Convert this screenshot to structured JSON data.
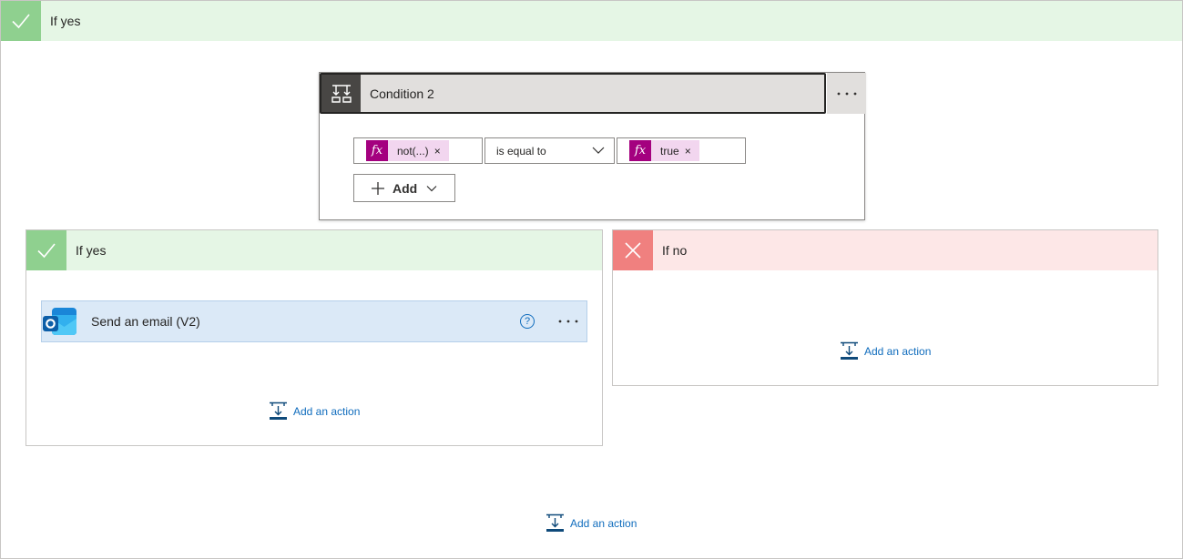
{
  "outer_branch": {
    "label": "If yes",
    "add_action_label": "Add an action"
  },
  "condition": {
    "title": "Condition 2",
    "left_token": {
      "icon": "fx-icon",
      "text": "not(...)",
      "remove": "×"
    },
    "operator": "is equal to",
    "right_token": {
      "icon": "fx-icon",
      "text": "true",
      "remove": "×"
    },
    "add_label": "Add"
  },
  "yes_branch": {
    "label": "If yes",
    "action": {
      "title": "Send an email (V2)",
      "help": "?"
    },
    "add_action_label": "Add an action"
  },
  "no_branch": {
    "label": "If no",
    "add_action_label": "Add an action"
  },
  "colors": {
    "yes_header_bg": "#e5f6e5",
    "yes_icon_bg": "#8fd08f",
    "no_header_bg": "#fde7e7",
    "no_icon_bg": "#f0807f",
    "expression_token": "#a4007f",
    "link": "#0f6cbd"
  }
}
